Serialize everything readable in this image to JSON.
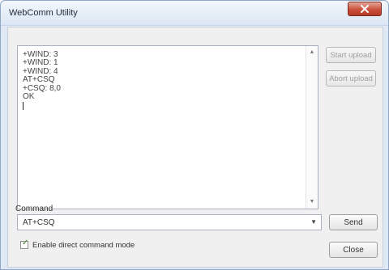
{
  "window": {
    "title": "WebComm Utility",
    "close_label": "X"
  },
  "output": {
    "lines": [
      "+WIND: 3",
      "+WIND: 1",
      "+WIND: 4",
      "AT+CSQ",
      "+CSQ: 8,0",
      "OK"
    ],
    "scroll_up_icon": "scroll-up-arrow",
    "scroll_down_icon": "scroll-down-arrow"
  },
  "side_buttons": {
    "start_upload": "Start upload",
    "abort_upload": "Abort upload"
  },
  "command": {
    "label": "Command",
    "value": "AT+CSQ",
    "send": "Send",
    "close": "Close"
  },
  "options": {
    "direct_mode_label": "Enable direct command mode",
    "direct_mode_checked": true
  }
}
